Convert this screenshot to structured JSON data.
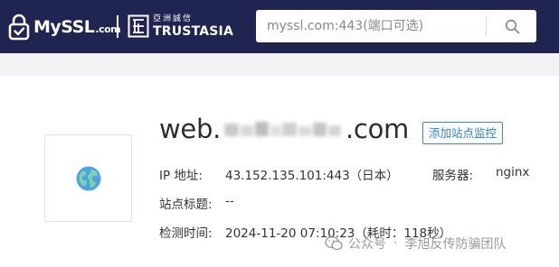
{
  "header": {
    "brand": {
      "name": "MySSL",
      "suffix": ".com",
      "partner_cn": "亞洲誠信",
      "partner_en": "TRUSTASIA"
    },
    "search": {
      "placeholder": "myssl.com:443(端口可选)",
      "value": "",
      "icon": "search-icon"
    },
    "colors": {
      "header_bg": "#1f2451",
      "accent": "#2f7ec4"
    }
  },
  "site": {
    "domain_prefix": "web.",
    "domain_suffix": ".com",
    "domain_obscured": true,
    "monitor_button": "添加站点监控",
    "thumbnail_icon": "globe-icon",
    "fields": {
      "ip_label": "IP 地址:",
      "ip_value": "43.152.135.101:443（日本）",
      "server_label": "服务器:",
      "server_value": "nginx",
      "title_label": "站点标题:",
      "title_value": "--",
      "time_label": "检测时间:",
      "time_value": "2024-11-20 07:10:23（耗时：118秒）"
    }
  },
  "watermark": {
    "icon": "wechat-official-account-icon",
    "source": "公众号",
    "separator": "·",
    "author": "李旭反传防骗团队"
  }
}
